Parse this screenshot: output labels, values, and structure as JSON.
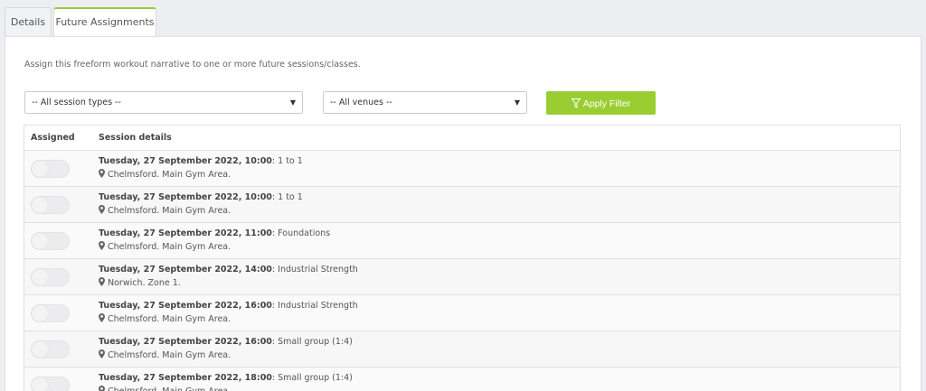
{
  "tabs": [
    {
      "label": "Details",
      "active": false
    },
    {
      "label": "Future Assignments",
      "active": true
    }
  ],
  "intro": "Assign this freeform workout narrative to one or more future sessions/classes.",
  "filters": {
    "session_types": "-- All session types --",
    "venues": "-- All venues --",
    "apply_label": "Apply Filter"
  },
  "table": {
    "headers": {
      "assigned": "Assigned",
      "details": "Session details"
    },
    "rows": [
      {
        "datetime": "Tuesday, 27 September 2022, 10:00",
        "name": ": 1 to 1",
        "location": "Chelmsford. Main Gym Area.",
        "assigned": false
      },
      {
        "datetime": "Tuesday, 27 September 2022, 10:00",
        "name": ": 1 to 1",
        "location": "Chelmsford. Main Gym Area.",
        "assigned": false
      },
      {
        "datetime": "Tuesday, 27 September 2022, 11:00",
        "name": ": Foundations",
        "location": "Chelmsford. Main Gym Area.",
        "assigned": false
      },
      {
        "datetime": "Tuesday, 27 September 2022, 14:00",
        "name": ": Industrial Strength",
        "location": "Norwich. Zone 1.",
        "assigned": false
      },
      {
        "datetime": "Tuesday, 27 September 2022, 16:00",
        "name": ": Industrial Strength",
        "location": "Chelmsford. Main Gym Area.",
        "assigned": false
      },
      {
        "datetime": "Tuesday, 27 September 2022, 16:00",
        "name": ": Small group (1:4)",
        "location": "Chelmsford. Main Gym Area.",
        "assigned": false
      },
      {
        "datetime": "Tuesday, 27 September 2022, 18:00",
        "name": ": Small group (1:4)",
        "location": "Chelmsford. Main Gym Area.",
        "assigned": false
      }
    ]
  },
  "colors": {
    "accent": "#9acd32",
    "tab_border_active": "#98c93c"
  }
}
